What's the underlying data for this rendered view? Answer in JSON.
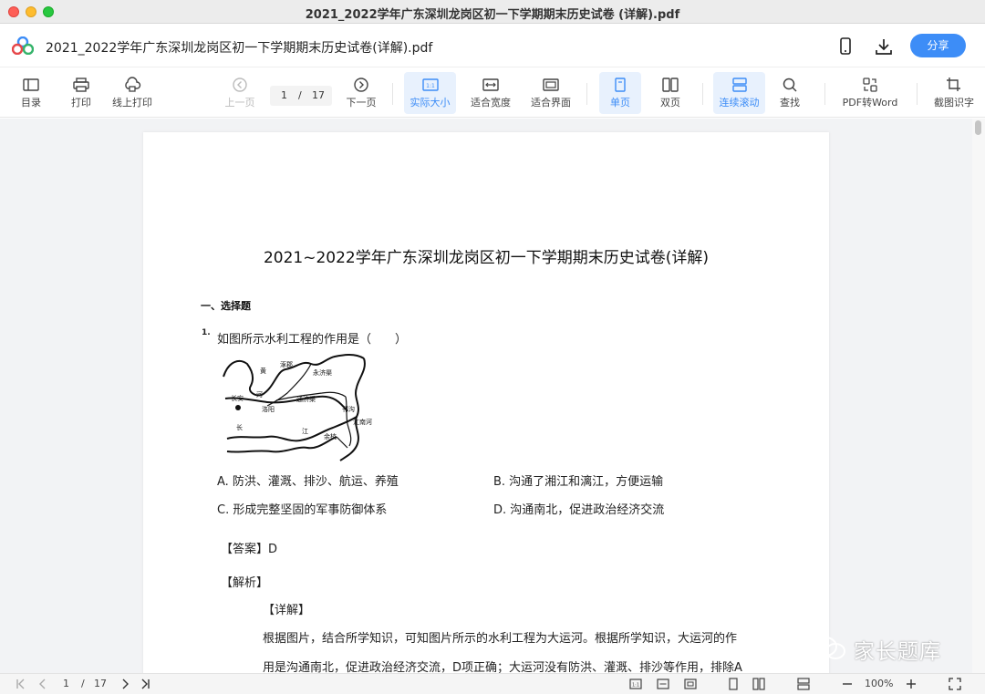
{
  "window": {
    "title": "2021_2022学年广东深圳龙岗区初一下学期期末历史试卷 (详解).pdf"
  },
  "header": {
    "doc_title": "2021_2022学年广东深圳龙岗区初一下学期期末历史试卷(详解).pdf",
    "share_label": "分享",
    "accent_color": "#3d8df7"
  },
  "toolbar": {
    "toc": "目录",
    "print": "打印",
    "online_print": "线上打印",
    "prev": "上一页",
    "current_page": "1",
    "separator": "/",
    "total_pages": "17",
    "next": "下一页",
    "actual_size": "实际大小",
    "fit_width": "适合宽度",
    "fit_page": "适合界面",
    "single_page": "单页",
    "double_page": "双页",
    "continuous": "连续滚动",
    "search": "查找",
    "pdf_to_word": "PDF转Word",
    "ocr": "截图识字"
  },
  "document": {
    "title": "2021~2022学年广东深圳龙岗区初一下学期期末历史试卷(详解)",
    "section": "一、选择题",
    "question_number": "1.",
    "question": "如图所示水利工程的作用是（　　）",
    "map_labels": {
      "huang": "黄",
      "zhuojun": "涿郡",
      "yongjiqu": "永济渠",
      "changan": "长安",
      "he": "河",
      "tongjiqu": "通济渠",
      "luoyang": "洛阳",
      "hangou": "邗沟",
      "jiangnanhe": "江南河",
      "chang": "长",
      "jiang": "江",
      "yuhang": "余杭"
    },
    "options": {
      "A": "A. 防洪、灌溉、排沙、航运、养殖",
      "B": "B. 沟通了湘江和漓江，方便运输",
      "C": "C. 形成完整坚固的军事防御体系",
      "D": "D. 沟通南北，促进政治经济交流"
    },
    "answer": "【答案】D",
    "analysis": "【解析】",
    "detail": "【详解】",
    "para1": "根据图片，结合所学知识，可知图片所示的水利工程为大运河。根据所学知识，大运河的作",
    "para2": "用是沟通南北，促进政治经济交流，D项正确；大运河没有防洪、灌溉、排沙等作用，排除A"
  },
  "watermark": {
    "text": "家长题库"
  },
  "bottombar": {
    "current_page": "1",
    "separator": "/",
    "total_pages": "17",
    "zoom": "100%"
  }
}
